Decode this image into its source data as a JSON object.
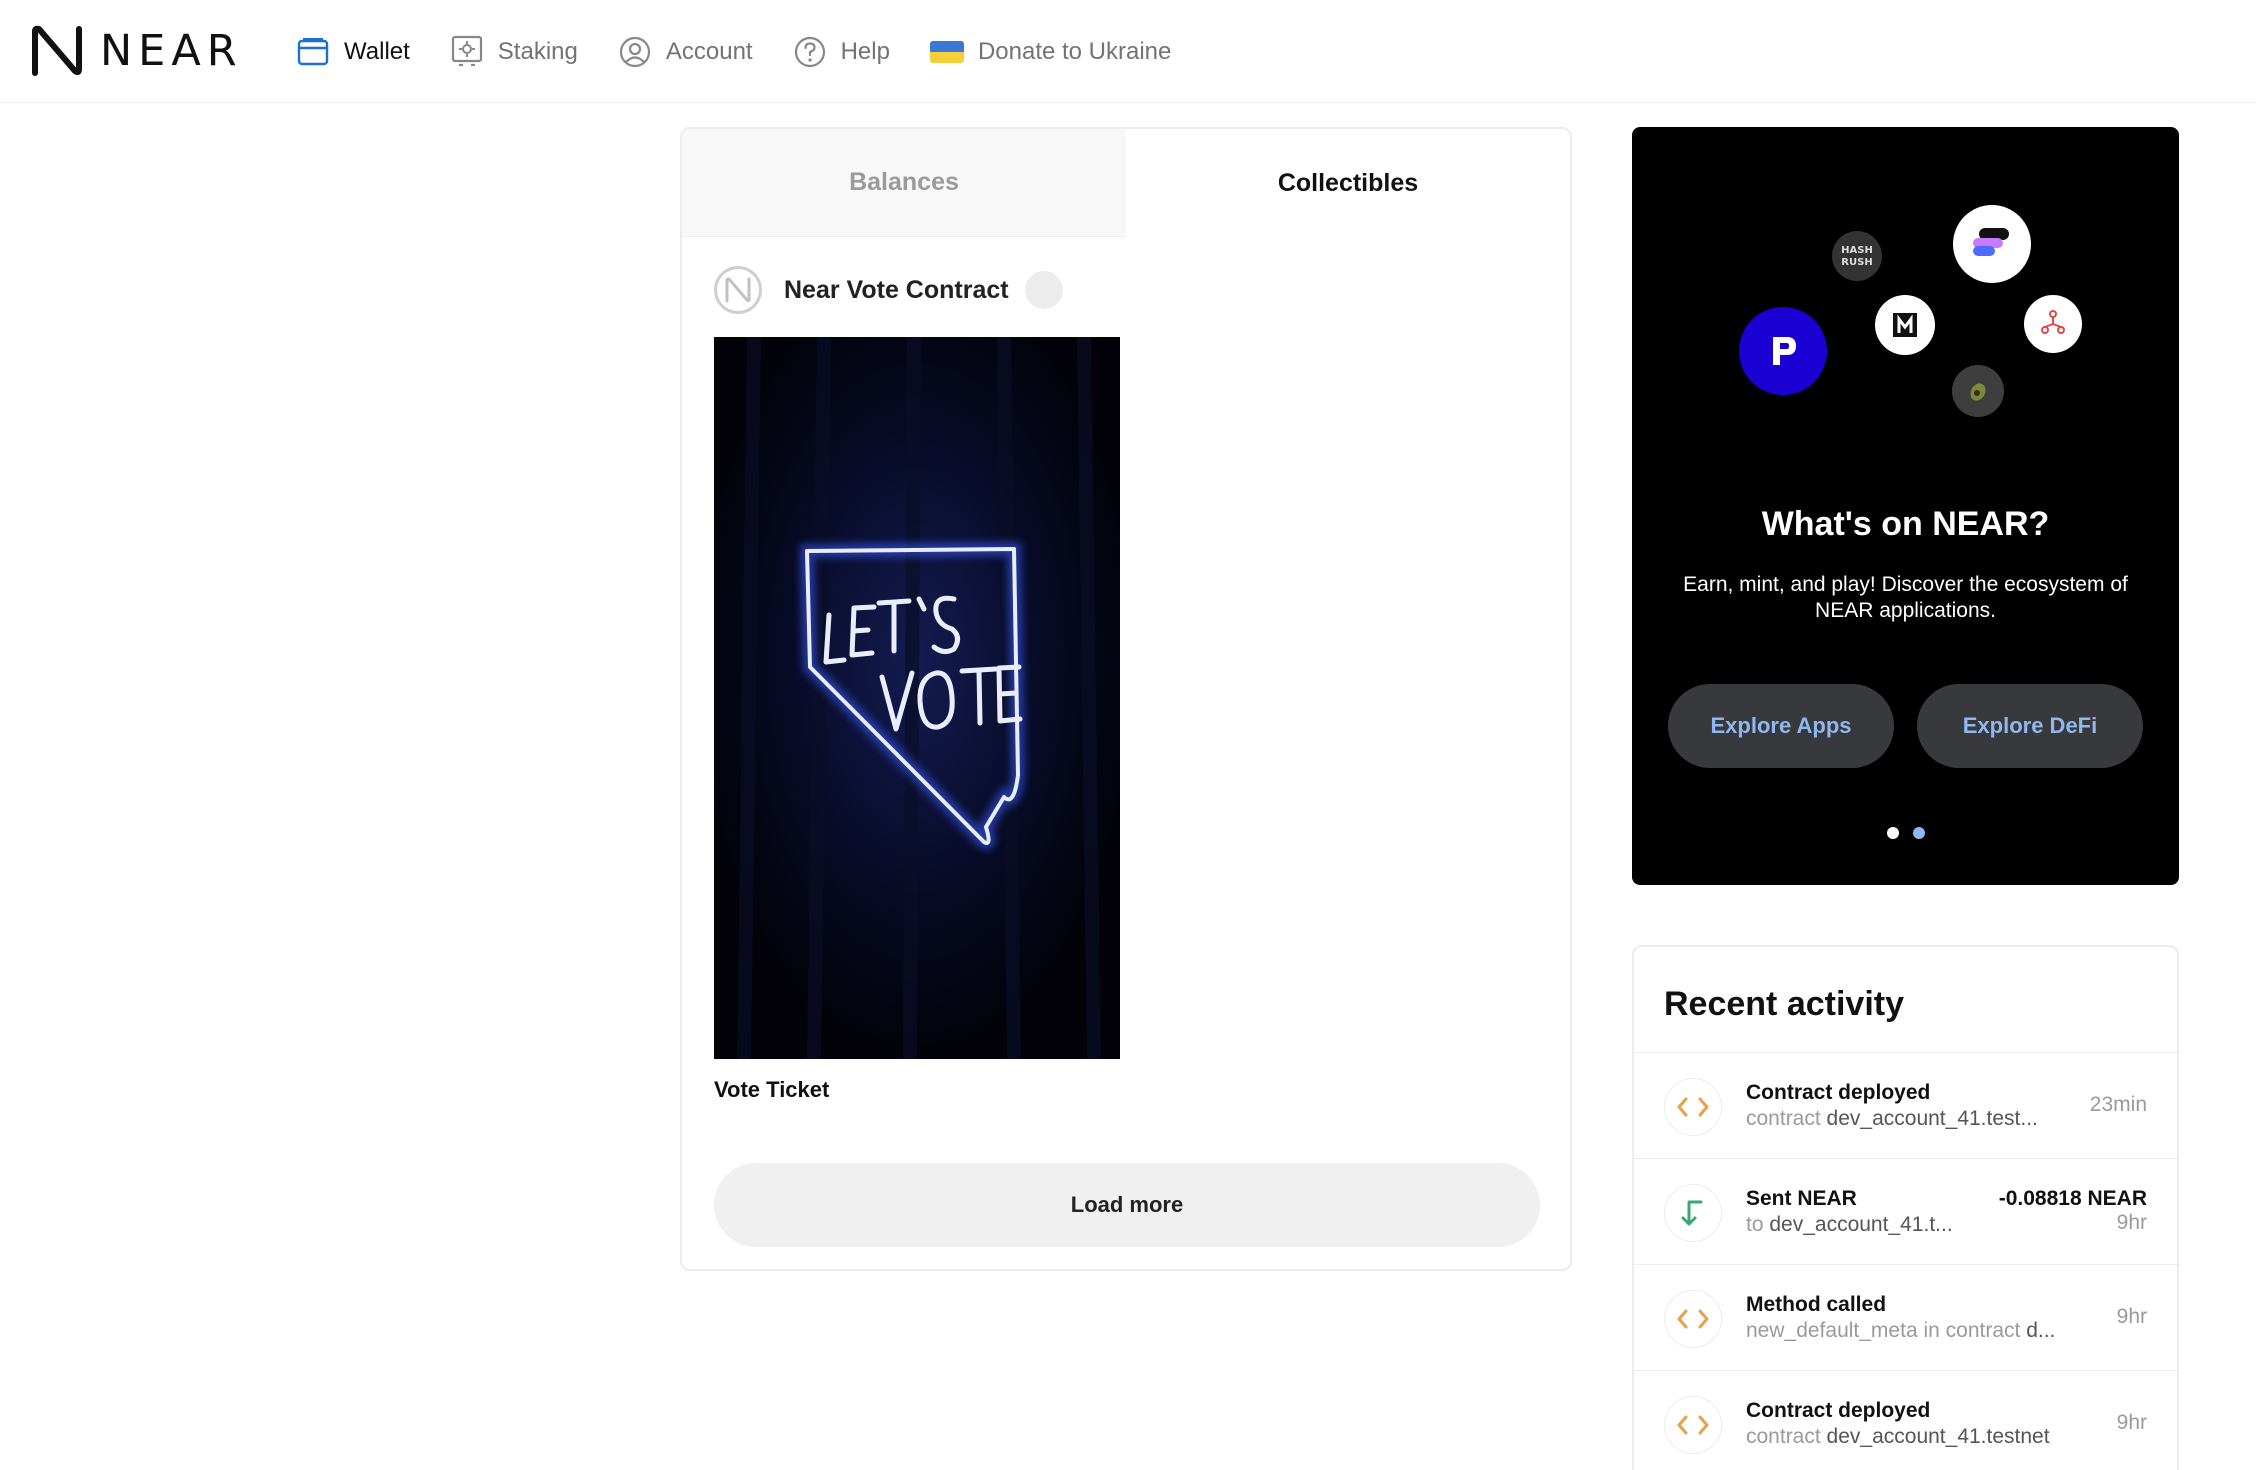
{
  "header": {
    "logo_text": "NEAR",
    "nav": [
      {
        "label": "Wallet",
        "icon": "wallet-icon",
        "active": true
      },
      {
        "label": "Staking",
        "icon": "staking-icon",
        "active": false
      },
      {
        "label": "Account",
        "icon": "account-icon",
        "active": false
      },
      {
        "label": "Help",
        "icon": "help-icon",
        "active": false
      },
      {
        "label": "Donate to Ukraine",
        "icon": "ukraine-flag-icon",
        "active": false
      }
    ]
  },
  "tabs": {
    "balances": "Balances",
    "collectibles": "Collectibles",
    "active": "collectibles"
  },
  "collection": {
    "name": "Near Vote Contract",
    "items": [
      {
        "title": "Vote Ticket",
        "image_text": [
          "LET'S",
          "VOTE"
        ]
      }
    ]
  },
  "load_more_label": "Load more",
  "promo": {
    "title": "What's on NEAR?",
    "description": "Earn, mint, and play! Discover the ecosystem of NEAR applications.",
    "buttons": {
      "apps": "Explore Apps",
      "defi": "Explore DeFi"
    },
    "app_logos": [
      "hash-rush-logo",
      "flux-logo",
      "paras-logo",
      "mintbase-logo",
      "ref-finance-logo",
      "avocado-logo"
    ],
    "hash_rush_text": [
      "HASH",
      "RUSH"
    ],
    "carousel": {
      "count": 2,
      "active": 1
    }
  },
  "activity": {
    "heading": "Recent activity",
    "items": [
      {
        "icon": "code-icon",
        "title": "Contract deployed",
        "prefix": "contract",
        "detail": "dev_account_41.test...",
        "time": "23min",
        "amount": ""
      },
      {
        "icon": "sent-arrow-icon",
        "title": "Sent NEAR",
        "prefix": "to",
        "detail": "dev_account_41.t...",
        "time": "9hr",
        "amount": "-0.08818 NEAR"
      },
      {
        "icon": "code-icon",
        "title": "Method called",
        "prefix": "new_default_meta in contract",
        "detail": "d...",
        "time": "9hr",
        "amount": ""
      },
      {
        "icon": "code-icon",
        "title": "Contract deployed",
        "prefix": "contract",
        "detail": "dev_account_41.testnet",
        "time": "9hr",
        "amount": ""
      }
    ]
  },
  "colors": {
    "accent_blue": "#1d6fd8",
    "activity_orange": "#e8a04a",
    "activity_green": "#3aa876",
    "promo_button_text": "#8fb8ee",
    "paras_blue": "#1b00d4"
  }
}
